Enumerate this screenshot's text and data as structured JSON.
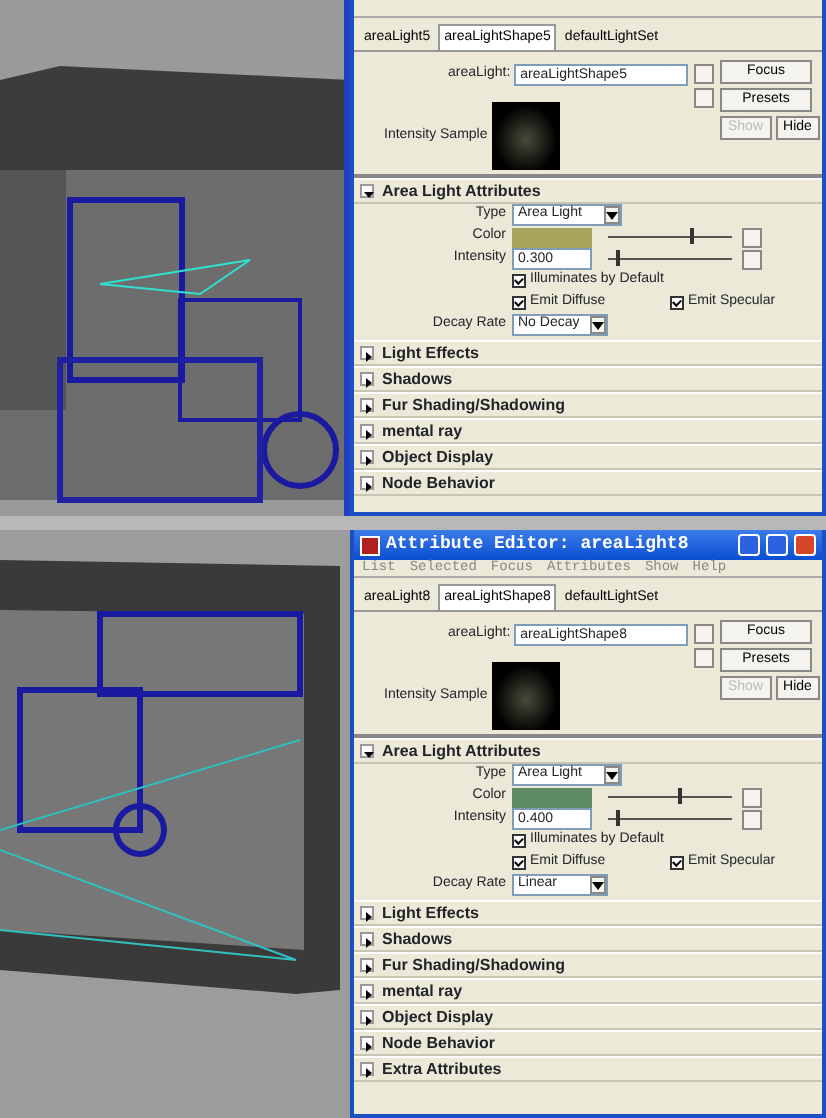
{
  "panels": [
    {
      "tabs": [
        {
          "label": "areaLight5",
          "selected": false
        },
        {
          "label": "areaLightShape5",
          "selected": true
        },
        {
          "label": "defaultLightSet",
          "selected": false
        }
      ],
      "node_label": "areaLight:",
      "node_value": "areaLightShape5",
      "buttons": [
        {
          "label": "Focus",
          "disabled": false
        },
        {
          "label": "Presets",
          "disabled": false
        },
        {
          "label": "Show",
          "disabled": true
        },
        {
          "label": "Hide",
          "disabled": false
        }
      ],
      "sample_label": "Intensity Sample",
      "section": {
        "title": "Area Light Attributes",
        "expanded": true
      },
      "type_label": "Type",
      "type_value": "Area Light",
      "color_label": "Color",
      "color": "#a7a45c",
      "color_slider": {
        "level": 0.66
      },
      "intensity_label": "Intensity",
      "intensity_value": "0.300",
      "intensity_slider": {
        "level": 0.06
      },
      "checkboxes": [
        {
          "label": "Illuminates by Default",
          "checked": true
        },
        {
          "label": "Emit Diffuse",
          "checked": true
        },
        {
          "label": "Emit Specular",
          "checked": true
        }
      ],
      "decay_label": "Decay Rate",
      "decay_value": "No Decay",
      "sections": [
        {
          "title": "Light Effects",
          "expanded": false
        },
        {
          "title": "Shadows",
          "expanded": false
        },
        {
          "title": "Fur Shading/Shadowing",
          "expanded": false
        },
        {
          "title": "mental ray",
          "expanded": false
        },
        {
          "title": "Object Display",
          "expanded": false
        },
        {
          "title": "Node Behavior",
          "expanded": false
        }
      ]
    },
    {
      "title": "Attribute Editor: areaLight8",
      "menu": [
        "List",
        "Selected",
        "Focus",
        "Attributes",
        "Show",
        "Help"
      ],
      "tabs": [
        {
          "label": "areaLight8",
          "selected": false
        },
        {
          "label": "areaLightShape8",
          "selected": true
        },
        {
          "label": "defaultLightSet",
          "selected": false
        }
      ],
      "node_label": "areaLight:",
      "node_value": "areaLightShape8",
      "buttons": [
        {
          "label": "Focus",
          "disabled": false
        },
        {
          "label": "Presets",
          "disabled": false
        },
        {
          "label": "Show",
          "disabled": true
        },
        {
          "label": "Hide",
          "disabled": false
        }
      ],
      "sample_label": "Intensity Sample",
      "section": {
        "title": "Area Light Attributes",
        "expanded": true
      },
      "type_label": "Type",
      "type_value": "Area Light",
      "color_label": "Color",
      "color": "#5e8a64",
      "color_slider": {
        "level": 0.56
      },
      "intensity_label": "Intensity",
      "intensity_value": "0.400",
      "intensity_slider": {
        "level": 0.06
      },
      "checkboxes": [
        {
          "label": "Illuminates by Default",
          "checked": true
        },
        {
          "label": "Emit Diffuse",
          "checked": true
        },
        {
          "label": "Emit Specular",
          "checked": true
        }
      ],
      "decay_label": "Decay Rate",
      "decay_value": "Linear",
      "sections": [
        {
          "title": "Light Effects",
          "expanded": false
        },
        {
          "title": "Shadows",
          "expanded": false
        },
        {
          "title": "Fur Shading/Shadowing",
          "expanded": false
        },
        {
          "title": "mental ray",
          "expanded": false
        },
        {
          "title": "Object Display",
          "expanded": false
        },
        {
          "title": "Node Behavior",
          "expanded": false
        },
        {
          "title": "Extra Attributes",
          "expanded": false
        }
      ]
    }
  ]
}
